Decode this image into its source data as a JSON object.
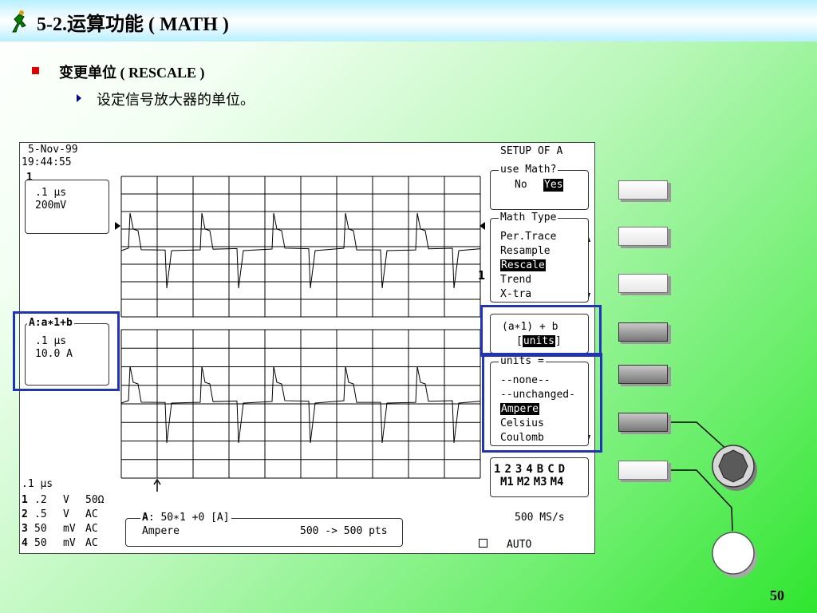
{
  "header": {
    "title": "5-2.运算功能 ( MATH )"
  },
  "bullets": {
    "level1": "变更单位 ( RESCALE )",
    "level2": "设定信号放大器的单位。"
  },
  "scope": {
    "date": "5-Nov-99",
    "time": "19:44:55",
    "ch1_box": {
      "id": "1",
      "line1": ".1 μs",
      "line2": "200mV"
    },
    "trace_a_box": {
      "label": "A:a∗1+b",
      "line1": ".1 μs",
      "line2": "10.0 A"
    },
    "timebase": ".1 μs",
    "channels": [
      {
        "id": "1",
        "volts": ".2",
        "unit": "V",
        "coupling": "50Ω"
      },
      {
        "id": "2",
        "volts": ".5",
        "unit": "V",
        "coupling": "AC"
      },
      {
        "id": "3",
        "volts": "50",
        "unit": "mV",
        "coupling": "AC"
      },
      {
        "id": "4",
        "volts": "50",
        "unit": "mV",
        "coupling": "AC"
      }
    ],
    "formula_panel": {
      "header_a": "A",
      "header_rest": ": 50∗1 +0 [A]",
      "unit": "Ampere",
      "points": "500 -> 500 pts"
    },
    "sample_rate": "500 MS/s",
    "trigger_mode": "AUTO",
    "trace_marker_1": "1",
    "menu": {
      "setup_title": "SETUP OF A",
      "use_math": {
        "label": "use Math?",
        "no": "No",
        "yes": "Yes"
      },
      "math_type": {
        "label": "Math Type",
        "items": [
          "Per.Trace",
          "Resample",
          "Rescale",
          "Trend",
          "X-tra"
        ],
        "selected": "Rescale"
      },
      "formula": {
        "line1": "(a∗1) + b",
        "bracket_open": "[",
        "units_word": "units",
        "bracket_close": "]"
      },
      "units": {
        "label": "units =",
        "items": [
          "--none--",
          "--unchanged-",
          "Ampere",
          "Celsius",
          "Coulomb"
        ],
        "selected": "Ampere"
      },
      "sources_row1": [
        "1",
        "2",
        "3",
        "4",
        "B",
        "C",
        "D"
      ],
      "sources_row2": [
        "M1",
        "M2",
        "M3",
        "M4"
      ]
    }
  },
  "page_number": "50"
}
